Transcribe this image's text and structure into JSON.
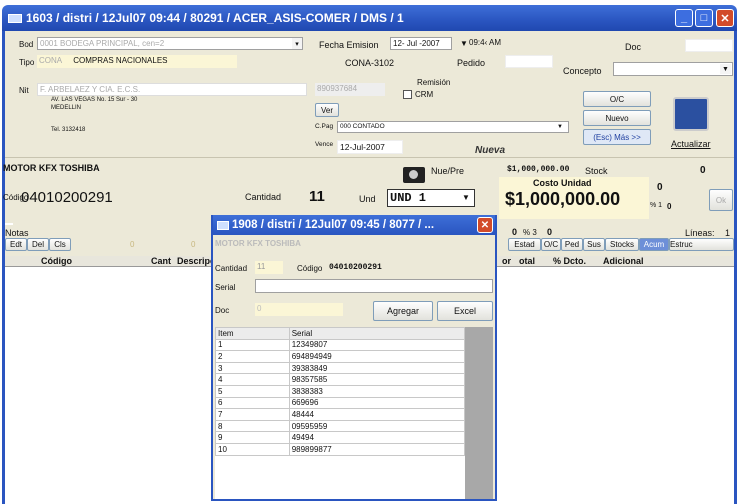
{
  "window": {
    "title": "1603 / distri / 12Jul07 09:44 / 80291 / ACER_ASIS-COMER / DMS / 1"
  },
  "header": {
    "bod_label": "Bod",
    "bod_value": "0001   BODEGA PRINCIPAL, cen=2",
    "tipo_label": "Tipo",
    "tipo_code": "CONA",
    "tipo_value": "COMPRAS NACIONALES",
    "fecha_label": "Fecha Emision",
    "fecha_value": "12- Jul -2007",
    "hora_value": "09:4‹ AM",
    "doc_label": "Doc",
    "concepto_label": "Concepto",
    "cona_doc": "CONA-3102",
    "pedido_label": "Pedido",
    "remision_label": "Remisión",
    "remision_value": "890937684",
    "crm_label": "CRM",
    "nit_label": "Nit",
    "nit_value": "F. ARBELAEZ Y CIA. E.C.S.",
    "address": "AV. LAS VEGAS No. 15 Sur - 30",
    "city": "MEDELLIN",
    "tel": "Tel. 3132418",
    "ver_label": "Ver",
    "cpag_label": "C.Pag",
    "cpag_value": "000 CONTADO",
    "vence_label": "Vence",
    "vence_value": "12-Jul-2007",
    "nueva_label": "Nueva",
    "oc_label": "O/C",
    "nuevo_label": "Nuevo",
    "esc_label": "(Esc) Más >>",
    "actualizar_label": "Actualizar"
  },
  "item": {
    "product": "MOTOR KFX TOSHIBA",
    "nuepre_label": "Nue/Pre",
    "price": "$1,000,000.00",
    "stock_label": "Stock",
    "stock_value": "0",
    "codigo_label": "Código",
    "codigo_value": "04010200291",
    "cantidad_label": "Cantidad",
    "cantidad_value": "11",
    "und_label": "Und",
    "und_value": "UND 1",
    "costo_label": "Costo Unidad",
    "costo_value": "$1,000,000.00",
    "pct_label": "% 1",
    "zero_a": "0",
    "zero_b": "0",
    "ok_label": "Ok"
  },
  "notes": {
    "notas_label": "Notas",
    "pct3_label": "% 3",
    "zero_c": "0",
    "zero_d": "0",
    "lineas_label": "Líneas:",
    "lineas_value": "1"
  },
  "toolbar": {
    "edit": "Edt",
    "del": "Del",
    "cls": "Cls",
    "t1": "0",
    "t2": "0",
    "tabs": [
      "Estad",
      "O/C",
      "Ped",
      "Sus",
      "Stocks",
      "Acum",
      "Estruc"
    ]
  },
  "grid": {
    "cols_left": [
      "Código",
      "Cant",
      "Descripci"
    ],
    "cols_right": [
      "or",
      "otal",
      "% Dcto.",
      "Adicional"
    ]
  },
  "dialog": {
    "title": "1908 / distri / 12Jul07 09:45 / 8077 / ...",
    "product": "MOTOR KFX TOSHIBA",
    "cantidad_label": "Cantidad",
    "cantidad_value": "11",
    "codigo_label": "Código",
    "codigo_value": "04010200291",
    "serial_label": "Serial",
    "doc_label": "Doc",
    "doc_value": "0",
    "agregar_label": "Agregar",
    "excel_label": "Excel",
    "col_item": "Item",
    "col_serial": "Serial",
    "rows": [
      {
        "item": "1",
        "serial": "12349807"
      },
      {
        "item": "2",
        "serial": "694894949"
      },
      {
        "item": "3",
        "serial": "39383849"
      },
      {
        "item": "4",
        "serial": "98357585"
      },
      {
        "item": "5",
        "serial": "3838383"
      },
      {
        "item": "6",
        "serial": "669696"
      },
      {
        "item": "7",
        "serial": "48444"
      },
      {
        "item": "8",
        "serial": "09595959"
      },
      {
        "item": "9",
        "serial": "49494"
      },
      {
        "item": "10",
        "serial": "989899877"
      }
    ]
  },
  "colors": {
    "title_blue": "#2a55c0",
    "close_red": "#d24b2a",
    "field_cream": "#fbf6d6",
    "accent_blue": "#1f3fa0"
  }
}
